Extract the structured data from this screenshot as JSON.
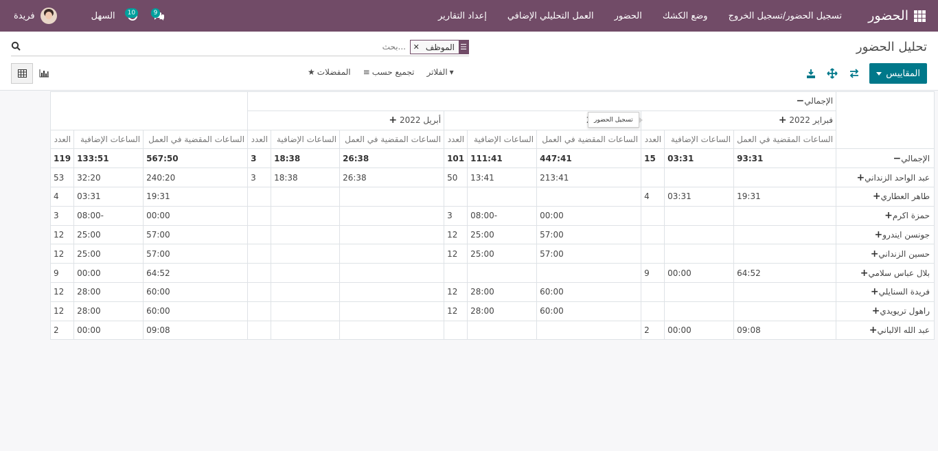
{
  "navbar": {
    "brand": "الحضور",
    "menu": [
      "تسجيل الحضور/تسجيل الخروج",
      "وضع الكشك",
      "الحضور",
      "العمل التحليلي الإضافي",
      "إعداد التقارير"
    ],
    "company": "السهل",
    "user": "فريدة",
    "messages_count": "9",
    "activities_count": "10"
  },
  "control_panel": {
    "breadcrumb": "تحليل الحضور",
    "facet_label": "الموظف",
    "search_placeholder": "بحث...",
    "measures_label": "المقاييس",
    "filters_label": "الفلاتر",
    "groupby_label": "تجميع حسب",
    "favorites_label": "المفضلات"
  },
  "tooltip": "تسجيل الحضور",
  "pivot": {
    "total_label": "الإجمالي",
    "col_groups": [
      {
        "label": "فبراير 2022",
        "short": ""
      },
      {
        "label": "2022",
        "short": "20"
      },
      {
        "label": "أبريل 2022",
        "short": ""
      }
    ],
    "measures": [
      "الساعات المقضية في العمل",
      "الساعات الإضافية",
      "العدد"
    ],
    "total_row": {
      "label": "الإجمالي",
      "cells": [
        "93:31",
        "03:31",
        "15",
        "447:41",
        "111:41",
        "101",
        "26:38",
        "18:38",
        "3",
        "567:50",
        "133:51",
        "119"
      ]
    },
    "rows": [
      {
        "label": "عبد الواحد الزنداني",
        "cells": [
          "",
          "",
          "",
          "213:41",
          "13:41",
          "50",
          "26:38",
          "18:38",
          "3",
          "240:20",
          "32:20",
          "53"
        ]
      },
      {
        "label": "طاهر العطاري",
        "cells": [
          "19:31",
          "03:31",
          "4",
          "",
          "",
          "",
          "",
          "",
          "",
          "19:31",
          "03:31",
          "4"
        ]
      },
      {
        "label": "حمزة اكرم",
        "cells": [
          "",
          "",
          "",
          "00:00",
          "-08:00",
          "3",
          "",
          "",
          "",
          "00:00",
          "-08:00",
          "3"
        ]
      },
      {
        "label": "جونسن ايندرو",
        "cells": [
          "",
          "",
          "",
          "57:00",
          "25:00",
          "12",
          "",
          "",
          "",
          "57:00",
          "25:00",
          "12"
        ]
      },
      {
        "label": "حسين الزنداني",
        "cells": [
          "",
          "",
          "",
          "57:00",
          "25:00",
          "12",
          "",
          "",
          "",
          "57:00",
          "25:00",
          "12"
        ]
      },
      {
        "label": "بلال عباس سلامي",
        "cells": [
          "64:52",
          "00:00",
          "9",
          "",
          "",
          "",
          "",
          "",
          "",
          "64:52",
          "00:00",
          "9"
        ]
      },
      {
        "label": "فريدة السنايلي",
        "cells": [
          "",
          "",
          "",
          "60:00",
          "28:00",
          "12",
          "",
          "",
          "",
          "60:00",
          "28:00",
          "12"
        ]
      },
      {
        "label": "راهول تريويدي",
        "cells": [
          "",
          "",
          "",
          "60:00",
          "28:00",
          "12",
          "",
          "",
          "",
          "60:00",
          "28:00",
          "12"
        ]
      },
      {
        "label": "عبد الله الالباني",
        "cells": [
          "09:08",
          "00:00",
          "2",
          "",
          "",
          "",
          "",
          "",
          "",
          "09:08",
          "00:00",
          "2"
        ]
      }
    ]
  }
}
